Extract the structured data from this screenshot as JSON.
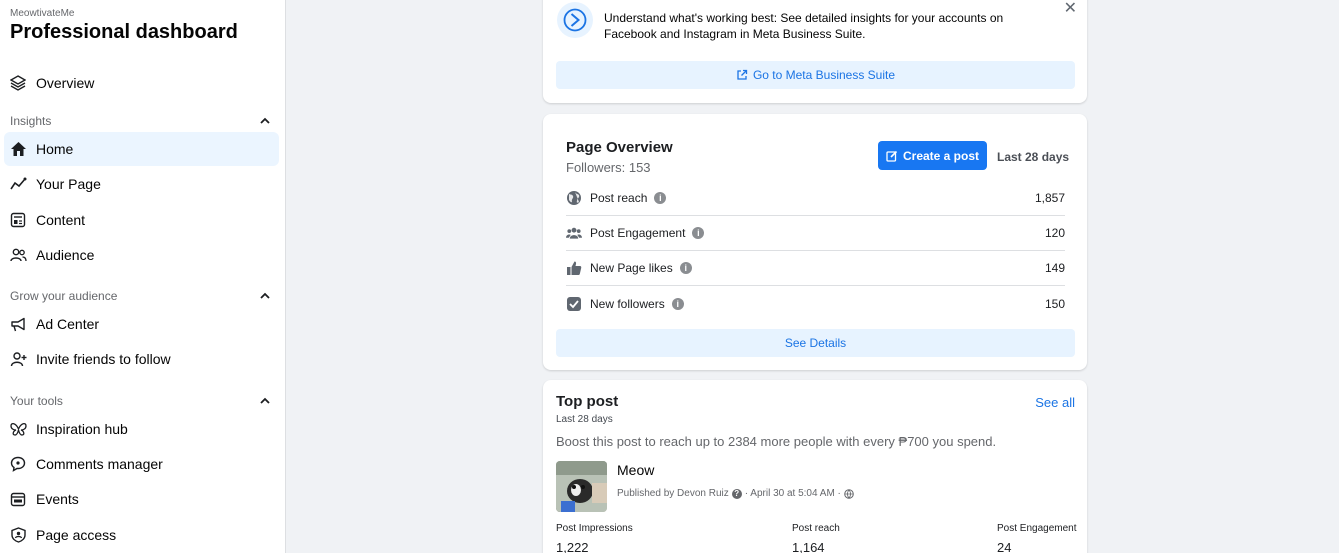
{
  "sidebar": {
    "brand_small": "MeowtivateMe",
    "brand_title": "Professional dashboard",
    "overview": "Overview",
    "sections": {
      "insights": "Insights",
      "grow": "Grow your audience",
      "tools": "Your tools"
    },
    "insights_items": [
      "Home",
      "Your Page",
      "Content",
      "Audience"
    ],
    "grow_items": [
      "Ad Center",
      "Invite friends to follow"
    ],
    "tools_items": [
      "Inspiration hub",
      "Comments manager",
      "Events",
      "Page access"
    ]
  },
  "banner": {
    "text": "Understand what's working best: See detailed insights for your accounts on Facebook and Instagram in Meta Business Suite.",
    "button": "Go to Meta Business Suite"
  },
  "overview": {
    "title": "Page Overview",
    "followers": "Followers: 153",
    "create_button": "Create a post",
    "range": "Last 28 days",
    "metrics": [
      {
        "label": "Post reach",
        "value": "1,857",
        "icon": "globe-icon"
      },
      {
        "label": "Post Engagement",
        "value": "120",
        "icon": "people-icon"
      },
      {
        "label": "New Page likes",
        "value": "149",
        "icon": "thumbs-up-icon"
      },
      {
        "label": "New followers",
        "value": "150",
        "icon": "check-box-icon"
      }
    ],
    "details_button": "See Details"
  },
  "top_post": {
    "title": "Top post",
    "see_all": "See all",
    "range": "Last 28 days",
    "boost_text": "Boost this post to reach up to 2384 more people with every ₱700 you spend.",
    "post_name": "Meow",
    "published_by": "Published by Devon Ruiz",
    "date": "· April 30 at 5:04 AM ·",
    "stats": [
      {
        "label": "Post Impressions",
        "value": "1,222"
      },
      {
        "label": "Post reach",
        "value": "1,164"
      },
      {
        "label": "Post Engagement",
        "value": "24"
      }
    ]
  },
  "colors": {
    "accent": "#1877f2",
    "link": "#1b74e4",
    "light_button": "#e7f3ff",
    "active_item": "#ebf5ff"
  }
}
